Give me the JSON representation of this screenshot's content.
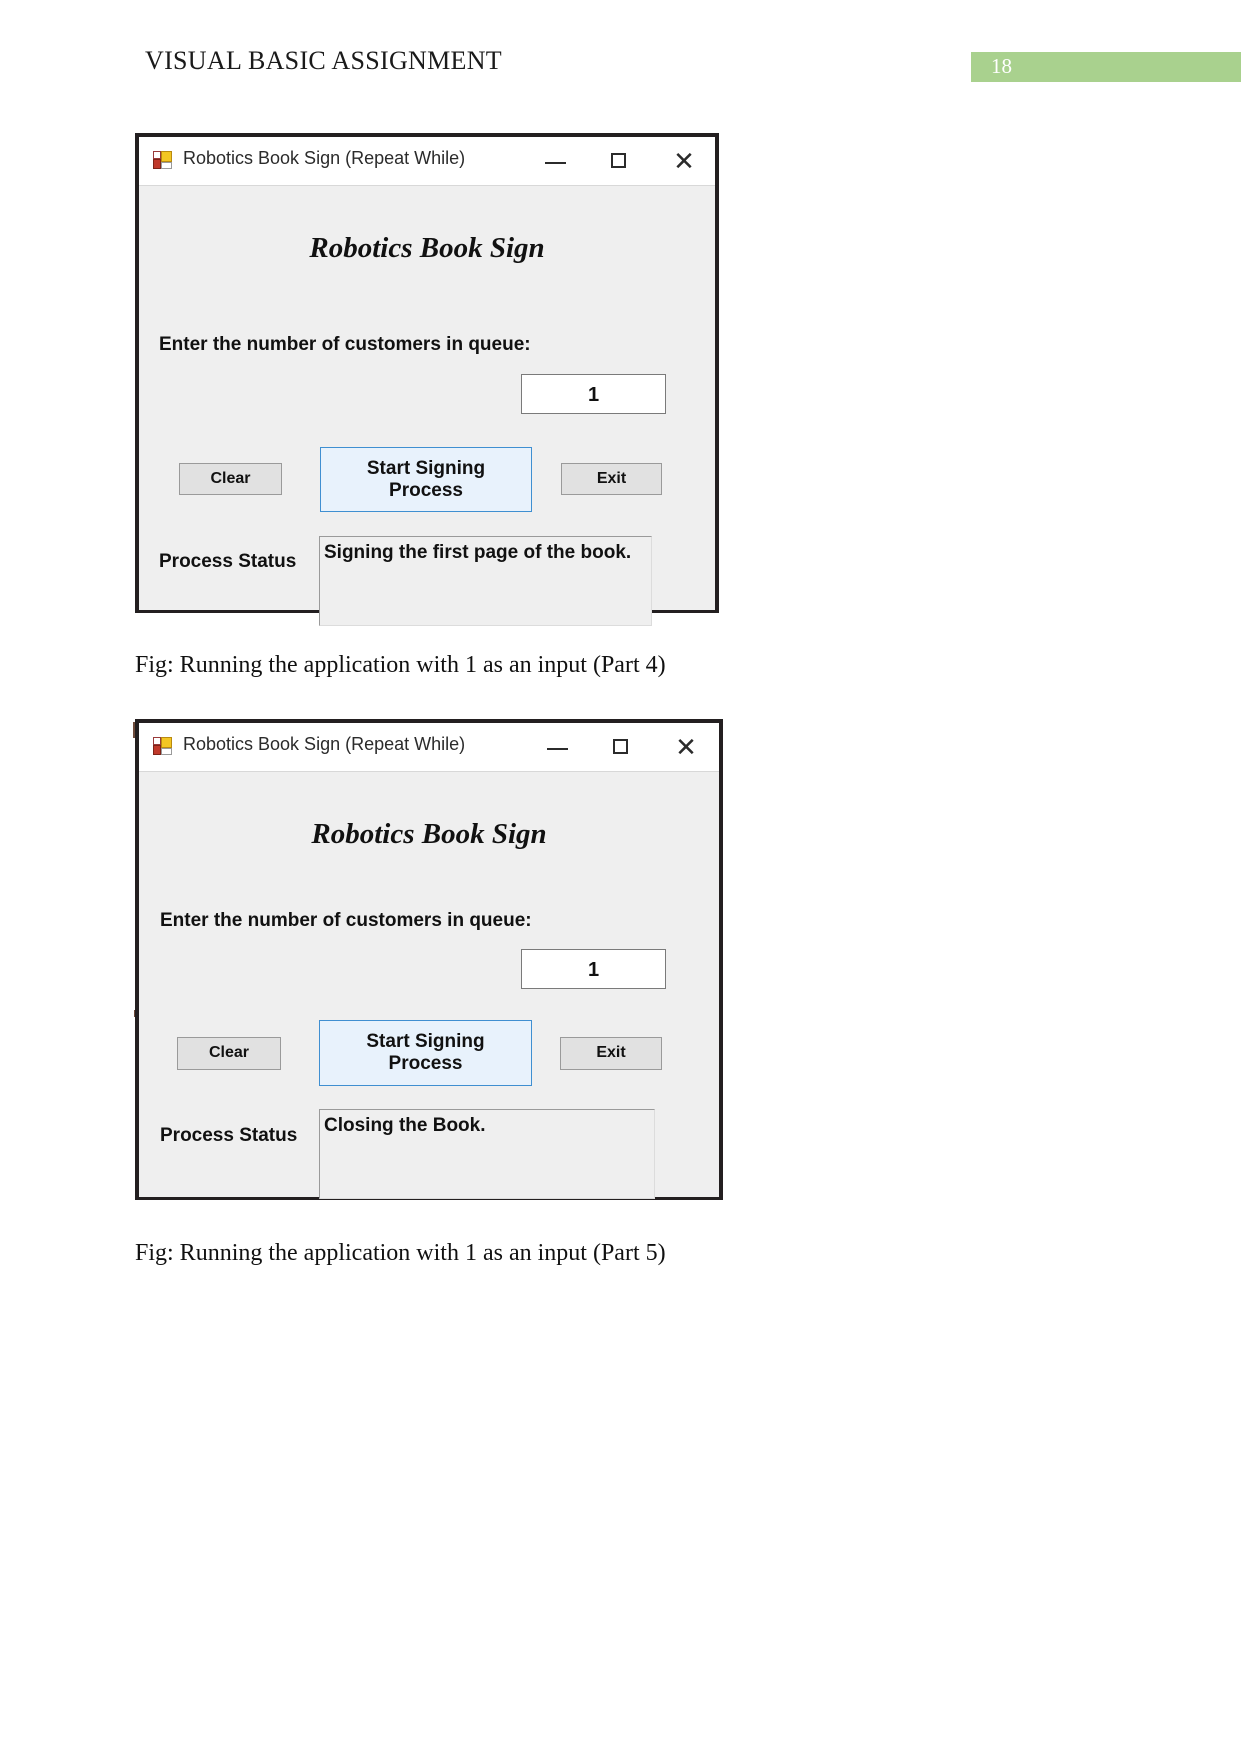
{
  "document": {
    "header_title": "VISUAL BASIC ASSIGNMENT",
    "page_number": "18",
    "badge_color": "#a9d18e"
  },
  "figures": [
    {
      "window": {
        "icon": "vb-form-icon",
        "title": "Robotics Book Sign (Repeat While)",
        "controls": {
          "minimize": "minimize-icon",
          "maximize": "maximize-icon",
          "close": "✕"
        },
        "heading": "Robotics Book Sign",
        "prompt_label": "Enter the number of customers in queue:",
        "input_value": "1",
        "buttons": {
          "clear": "Clear",
          "primary": "Start Signing\nProcess",
          "primary_line1": "Start Signing",
          "primary_line2": "Process",
          "exit": "Exit"
        },
        "status_label": "Process Status",
        "status_value": "Signing the first page of the book."
      },
      "caption": "Fig: Running the application with 1 as an input (Part 4)"
    },
    {
      "window": {
        "icon": "vb-form-icon",
        "title": "Robotics Book Sign (Repeat While)",
        "controls": {
          "minimize": "minimize-icon",
          "maximize": "maximize-icon",
          "close": "✕"
        },
        "heading": "Robotics Book Sign",
        "prompt_label": "Enter the number of customers in queue:",
        "input_value": "1",
        "buttons": {
          "clear": "Clear",
          "primary": "Start Signing\nProcess",
          "primary_line1": "Start Signing",
          "primary_line2": "Process",
          "exit": "Exit"
        },
        "status_label": "Process Status",
        "status_value": "Closing the Book."
      },
      "caption": "Fig: Running the application with 1 as an input (Part 5)"
    }
  ]
}
